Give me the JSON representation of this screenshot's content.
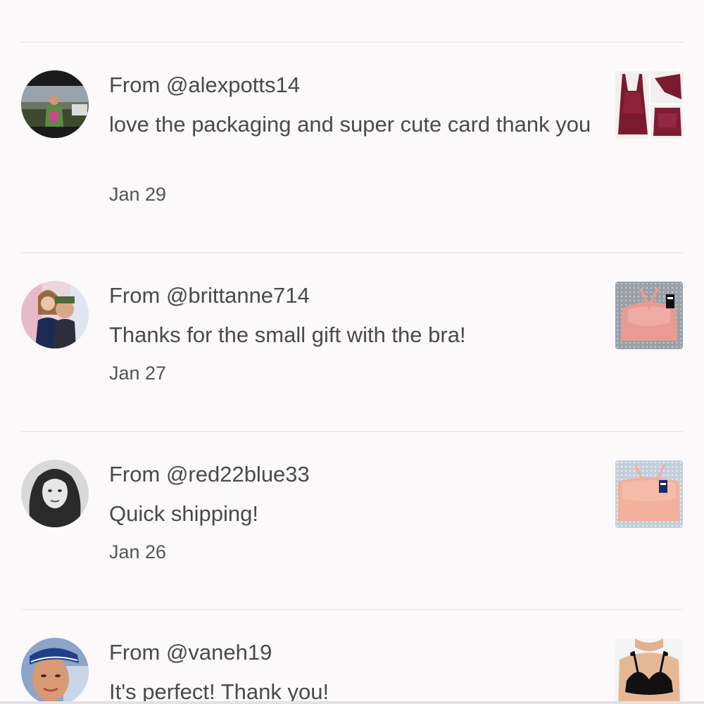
{
  "reviews": [
    {
      "from_prefix": "From ",
      "username": "@alexpotts14",
      "comment": "love the packaging and super cute card thank you",
      "date": "Jan 29",
      "avatar_icon": "user-avatar-outdoor",
      "thumbnail_icon": "burgundy-lingerie-set"
    },
    {
      "from_prefix": "From ",
      "username": "@brittanne714",
      "comment": "Thanks for the small gift with the bra!",
      "date": "Jan 27",
      "avatar_icon": "user-avatar-couple",
      "thumbnail_icon": "pink-bralette"
    },
    {
      "from_prefix": "From ",
      "username": "@red22blue33",
      "comment": "Quick shipping!",
      "date": "Jan 26",
      "avatar_icon": "user-avatar-bw-portrait",
      "thumbnail_icon": "peach-bralette"
    },
    {
      "from_prefix": "From ",
      "username": "@vaneh19",
      "comment": "It's perfect! Thank you!",
      "date": "",
      "avatar_icon": "user-avatar-cap",
      "thumbnail_icon": "black-bralette-model"
    }
  ],
  "colors": {
    "background": "#fbf9fa",
    "text": "#4a4a4a",
    "divider": "#efebec"
  }
}
